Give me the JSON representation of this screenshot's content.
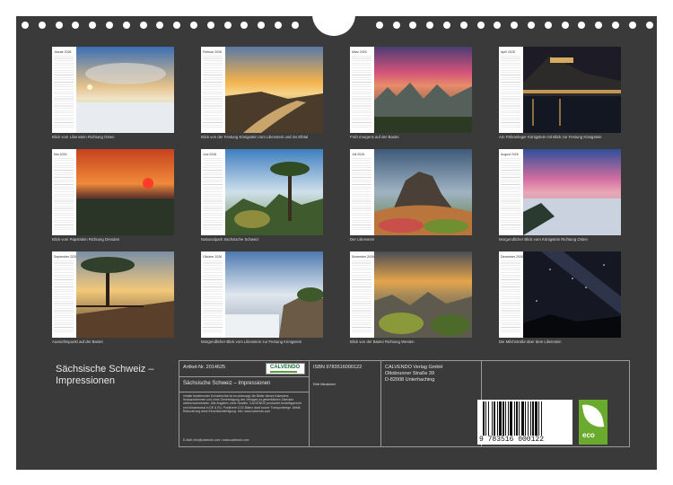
{
  "months": [
    {
      "title": "Januar 2026",
      "caption": "Blick vom Lilienstein Richtung Osten"
    },
    {
      "title": "Februar 2026",
      "caption": "Blick von der Festung Königstein zum Lilienstein und ins Elbtal"
    },
    {
      "title": "März 2026",
      "caption": "Früh morgens auf der Bastei"
    },
    {
      "title": "April 2026",
      "caption": "Am Fähranleger Königstein mit Blick zur Festung Königstein"
    },
    {
      "title": "Mai 2026",
      "caption": "Blick vom Papststein Richtung Dresden"
    },
    {
      "title": "Juni 2026",
      "caption": "Nationalpark Sächsische Schweiz"
    },
    {
      "title": "Juli 2026",
      "caption": "Der Lilienstein"
    },
    {
      "title": "August 2026",
      "caption": "Morgendlicher Blick vom Königstein Richtung Osten"
    },
    {
      "title": "September 2026",
      "caption": "Aussichtspunkt auf der Bastei"
    },
    {
      "title": "Oktober 2026",
      "caption": "Morgendlicher Blick vom Lilienstein zur Festung Königstein"
    },
    {
      "title": "November 2026",
      "caption": "Blick von der Bastei Richtung Westen"
    },
    {
      "title": "Dezember 2026",
      "caption": "Die Milchstraße über dem Lilienstein"
    }
  ],
  "calendar_title_line1": "Sächsische Schweiz –",
  "calendar_title_line2": "Impressionen",
  "info": {
    "article": "Artikel-Nr. 2014625",
    "calvendo_logo": "CALVENDO",
    "title": "Sächsische Schweiz – Impressionen",
    "isbn": "ISBN 9783516000122",
    "author": "Dirk Meutzner",
    "publisher": "CALVENDO Verlag GmbH",
    "street": "Ottobrunner Straße 39",
    "city": "D-82008 Unterhaching",
    "legal_text": "Inhalte beste­hender Schutzrechte ist es untersagt, die Bilder dieses Kalenders herauszutrennen und ohne Genehmigung des Verlages zu gewerblichen Zwecken weiterzuverwenden. Alle Angaben ohne Gewähr. CALVENDO produziert bedarfsgerecht und klimaneutral in DE & EU. Positivere CO2-Bilanz dank kurzer Transportwege. Abfall-Reduzierung dank Einzelstückfertigung. Info: www.calvendo.com",
    "email": "E-Mail: info@calvendo.com • www.calvendo.com"
  },
  "barcode_digits": "9 783516 000122",
  "eco_label": "eco"
}
